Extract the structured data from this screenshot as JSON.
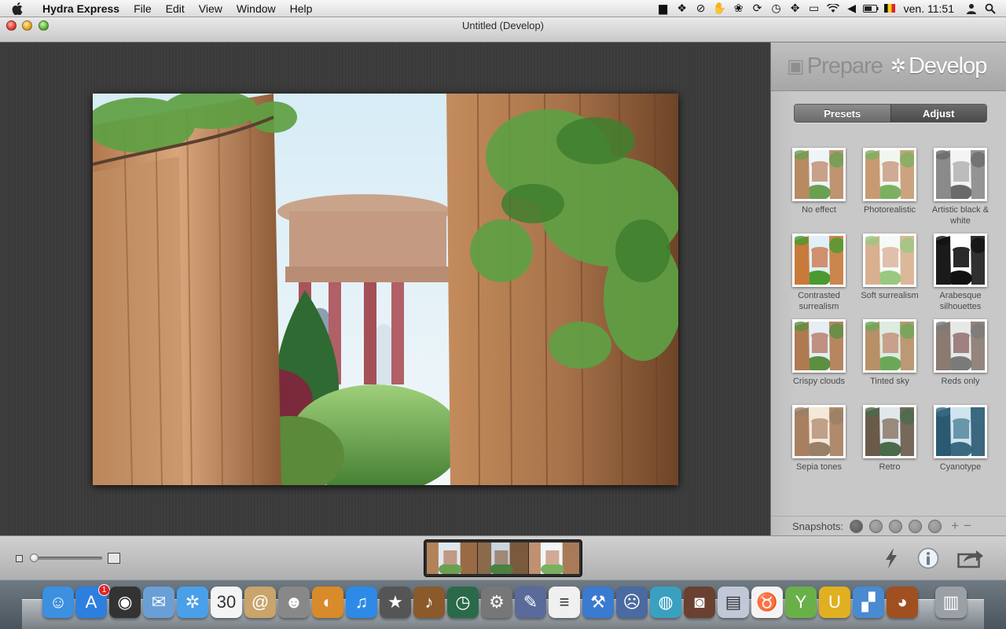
{
  "menubar": {
    "apple_icon": "apple-logo-icon",
    "app_name": "Hydra Express",
    "menus": [
      "File",
      "Edit",
      "View",
      "Window",
      "Help"
    ],
    "status_icons": [
      "folder-icon",
      "dropbox-icon",
      "block-icon",
      "hand-icon",
      "paw-icon",
      "sync-icon",
      "time-machine-icon",
      "move-icon",
      "display-icon",
      "wifi-icon",
      "volume-icon",
      "battery-icon",
      "flag-icon"
    ],
    "clock": "ven. 11:51",
    "user_icon": "user-icon",
    "search_icon": "spotlight-icon"
  },
  "window": {
    "title": "Untitled (Develop)"
  },
  "panel": {
    "modes": {
      "prepare": "Prepare",
      "develop": "Develop"
    },
    "tabs": {
      "presets": "Presets",
      "adjust": "Adjust"
    },
    "presets": [
      {
        "label": "No effect",
        "style": "normal"
      },
      {
        "label": "Photorealistic",
        "style": "photo"
      },
      {
        "label": "Artistic black & white",
        "style": "bw"
      },
      {
        "label": "Contrasted surrealism",
        "style": "contrast"
      },
      {
        "label": "Soft surrealism",
        "style": "soft"
      },
      {
        "label": "Arabesque silhouettes",
        "style": "silhouette"
      },
      {
        "label": "Crispy clouds",
        "style": "crispy"
      },
      {
        "label": "Tinted sky",
        "style": "tinted"
      },
      {
        "label": "Reds only",
        "style": "reds"
      },
      {
        "label": "Sepia tones",
        "style": "sepia"
      },
      {
        "label": "Retro",
        "style": "retro"
      },
      {
        "label": "Cyanotype",
        "style": "cyan"
      }
    ],
    "snapshots": {
      "label": "Snapshots:",
      "count": 5,
      "add": "+",
      "remove": "−"
    }
  },
  "toolbar": {
    "zoom_level": 0.0,
    "film_frames": 3
  },
  "dock": {
    "items": [
      {
        "name": "finder-icon",
        "glyph": "☺",
        "bg": "#3d8fe0"
      },
      {
        "name": "app-store-icon",
        "glyph": "A",
        "bg": "#2d7fe0",
        "badge": "1"
      },
      {
        "name": "dashboard-icon",
        "glyph": "◉",
        "bg": "#333"
      },
      {
        "name": "mail-icon",
        "glyph": "✉",
        "bg": "#6a9fd6"
      },
      {
        "name": "safari-icon",
        "glyph": "✲",
        "bg": "#4aa0e8"
      },
      {
        "name": "calendar-icon",
        "glyph": "30",
        "bg": "#f4f4f4"
      },
      {
        "name": "address-book-icon",
        "glyph": "@",
        "bg": "#c9a46b"
      },
      {
        "name": "photo-booth-icon",
        "glyph": "☻",
        "bg": "#888"
      },
      {
        "name": "iphoto-icon",
        "glyph": "◐",
        "bg": "#d98a2a"
      },
      {
        "name": "itunes-icon",
        "glyph": "♫",
        "bg": "#2d8ae6"
      },
      {
        "name": "imovie-icon",
        "glyph": "★",
        "bg": "#555"
      },
      {
        "name": "garageband-icon",
        "glyph": "♪",
        "bg": "#8a5a2a"
      },
      {
        "name": "time-machine-icon",
        "glyph": "◷",
        "bg": "#2a6a4a"
      },
      {
        "name": "system-preferences-icon",
        "glyph": "⚙",
        "bg": "#777"
      },
      {
        "name": "script-editor-icon",
        "glyph": "✎",
        "bg": "#5a6a9a"
      },
      {
        "name": "textedit-icon",
        "glyph": "≡",
        "bg": "#f0f0f0"
      },
      {
        "name": "xcode-icon",
        "glyph": "⚒",
        "bg": "#3a7ad0"
      },
      {
        "name": "face-app-icon",
        "glyph": "☹",
        "bg": "#4a6aa0"
      },
      {
        "name": "globe-app-icon",
        "glyph": "◍",
        "bg": "#3aa0c0"
      },
      {
        "name": "camera-app-icon",
        "glyph": "◙",
        "bg": "#6a4030"
      },
      {
        "name": "image-capture-icon",
        "glyph": "▤",
        "bg": "#c0c8d8"
      },
      {
        "name": "cow-app-icon",
        "glyph": "♉",
        "bg": "#f4f4f4"
      },
      {
        "name": "cocktail-icon",
        "glyph": "Y",
        "bg": "#6ab04a"
      },
      {
        "name": "magnet-icon",
        "glyph": "U",
        "bg": "#e0b020"
      },
      {
        "name": "stack-icon",
        "glyph": "▞",
        "bg": "#4a8ad0"
      },
      {
        "name": "hydra-icon",
        "glyph": "◕",
        "bg": "#a05020"
      },
      {
        "name": "trash-icon",
        "glyph": "▥",
        "bg": "#9aa0a6"
      }
    ]
  }
}
